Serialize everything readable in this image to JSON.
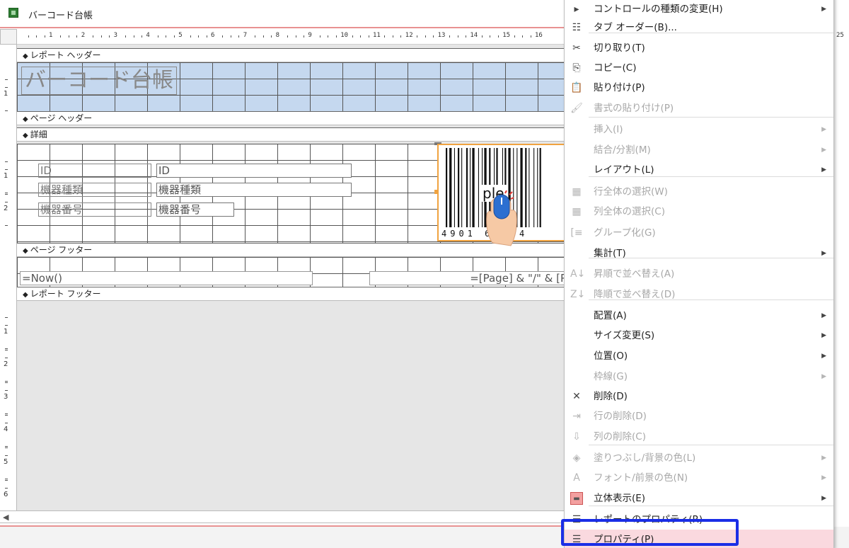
{
  "window": {
    "title": "バーコード台帳"
  },
  "ruler": {
    "marks": [
      "1",
      "2",
      "3",
      "4",
      "5",
      "6",
      "7",
      "8",
      "9",
      "10",
      "11",
      "12",
      "13",
      "14",
      "15",
      "16"
    ],
    "edge_mark": "25"
  },
  "vruler": {
    "header_marks": [
      "1"
    ],
    "detail_marks": [
      "1",
      "2"
    ],
    "lower_marks": [
      "1",
      "2",
      "3",
      "4",
      "5",
      "6"
    ]
  },
  "sections": {
    "report_header": "レポート ヘッダー",
    "page_header": "ページ ヘッダー",
    "detail": "詳細",
    "page_footer": "ページ フッター",
    "report_footer": "レポート フッター"
  },
  "controls": {
    "title_label": "バーコード台帳",
    "id_label": "ID",
    "id_field": "ID",
    "type_label": "機器種類",
    "type_field": "機器種類",
    "number_label": "機器番号",
    "number_field": "機器番号",
    "now_field": "=Now()",
    "page_field": "=[Page] & \"/\" & [P"
  },
  "barcode": {
    "digits": "4901  67894",
    "overlay": "Sample",
    "overlay_visible": "ple"
  },
  "menu": {
    "items": [
      {
        "label": "コントロールの種類の変更(H)",
        "icon": "change-control-icon",
        "submenu": true,
        "disabled": false
      },
      {
        "label": "タブ オーダー(B)...",
        "icon": "tab-order-icon",
        "submenu": false,
        "disabled": false
      },
      {
        "label": "切り取り(T)",
        "icon": "scissors-icon",
        "submenu": false,
        "disabled": false
      },
      {
        "label": "コピー(C)",
        "icon": "copy-icon",
        "submenu": false,
        "disabled": false
      },
      {
        "label": "貼り付け(P)",
        "icon": "paste-icon",
        "submenu": false,
        "disabled": false
      },
      {
        "label": "書式の貼り付け(P)",
        "icon": "format-paste-icon",
        "submenu": false,
        "disabled": true
      },
      {
        "label": "挿入(I)",
        "icon": "",
        "submenu": true,
        "disabled": true
      },
      {
        "label": "結合/分割(M)",
        "icon": "",
        "submenu": true,
        "disabled": true
      },
      {
        "label": "レイアウト(L)",
        "icon": "",
        "submenu": true,
        "disabled": false
      },
      {
        "label": "行全体の選択(W)",
        "icon": "select-row-icon",
        "submenu": false,
        "disabled": true
      },
      {
        "label": "列全体の選択(C)",
        "icon": "select-column-icon",
        "submenu": false,
        "disabled": true
      },
      {
        "label": "グループ化(G)",
        "icon": "group-icon",
        "submenu": false,
        "disabled": true
      },
      {
        "label": "集計(T)",
        "icon": "",
        "submenu": true,
        "disabled": false
      },
      {
        "label": "昇順で並べ替え(A)",
        "icon": "sort-ascending-icon",
        "submenu": false,
        "disabled": true
      },
      {
        "label": "降順で並べ替え(D)",
        "icon": "sort-descending-icon",
        "submenu": false,
        "disabled": true
      },
      {
        "label": "配置(A)",
        "icon": "",
        "submenu": true,
        "disabled": false
      },
      {
        "label": "サイズ変更(S)",
        "icon": "",
        "submenu": true,
        "disabled": false
      },
      {
        "label": "位置(O)",
        "icon": "",
        "submenu": true,
        "disabled": false
      },
      {
        "label": "枠線(G)",
        "icon": "",
        "submenu": true,
        "disabled": true
      },
      {
        "label": "削除(D)",
        "icon": "delete-icon",
        "submenu": false,
        "disabled": false
      },
      {
        "label": "行の削除(D)",
        "icon": "delete-row-icon",
        "submenu": false,
        "disabled": true
      },
      {
        "label": "列の削除(C)",
        "icon": "delete-column-icon",
        "submenu": false,
        "disabled": true
      },
      {
        "label": "塗りつぶし/背景の色(L)",
        "icon": "fill-color-icon",
        "submenu": true,
        "disabled": true
      },
      {
        "label": "フォント/前景の色(N)",
        "icon": "font-color-icon",
        "submenu": true,
        "disabled": true
      },
      {
        "label": "立体表示(E)",
        "icon": "3d-effect-icon",
        "submenu": true,
        "disabled": false
      },
      {
        "label": "レポートのプロパティ(R)",
        "icon": "report-properties-icon",
        "submenu": false,
        "disabled": false
      },
      {
        "label": "プロパティ(P)",
        "icon": "properties-icon",
        "submenu": false,
        "disabled": false
      }
    ]
  },
  "colors": {
    "accent_highlight": "#1a2ee6",
    "selection_border": "#f0a340",
    "report_header_fill": "#c5d8ef",
    "active_item_bg": "#fad9df"
  }
}
